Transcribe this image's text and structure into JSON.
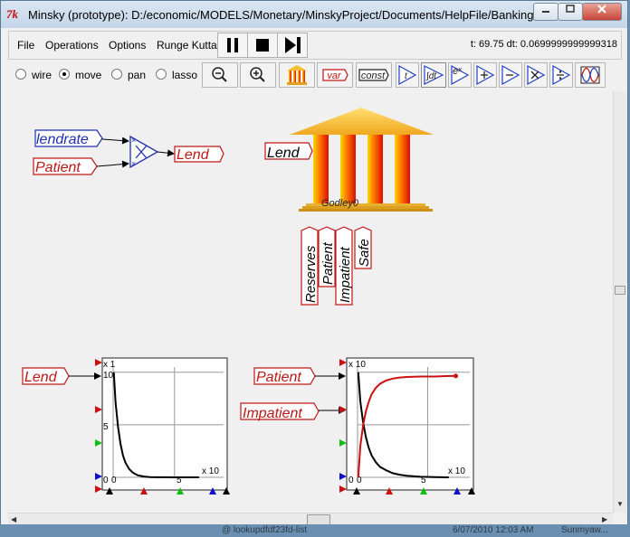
{
  "window": {
    "title": "Minsky (prototype): D:/economic/MODELS/Monetary/MinskyProject/Documents/HelpFile/BankingExa...",
    "app_icon": "tk-feather-icon"
  },
  "menu": {
    "file": "File",
    "operations": "Operations",
    "options": "Options",
    "runge_kutta": "Runge Kutta"
  },
  "run_controls": [
    "pause",
    "stop",
    "step"
  ],
  "status": {
    "text": "t: 69.75 dt: 0.0699999999999318"
  },
  "modes": {
    "wire": "wire",
    "move": "move",
    "pan": "pan",
    "lasso": "lasso",
    "selected": "move"
  },
  "toolbar": {
    "var_label": "var",
    "const_label": "const",
    "time_label": "t",
    "integral_label": "∫dt",
    "exp_label": "eˣ"
  },
  "canvas": {
    "inputs": {
      "lendrate": "lendrate",
      "patient": "Patient",
      "lend": "Lend"
    },
    "godley": {
      "name": "Godley0",
      "var": "Lend",
      "accounts": [
        "Reserves",
        "Patient",
        "Impatient",
        "Safe"
      ]
    },
    "plot1": {
      "input": "Lend",
      "y_exp": "x 1",
      "x_exp": "x 10",
      "y_max": "10",
      "y_mid": "5",
      "y_min": "0",
      "x_min": "0",
      "x_mid": "5"
    },
    "plot2": {
      "input1": "Patient",
      "input2": "Impatient",
      "y_exp": "x 10",
      "x_exp": "x 10",
      "y_min": "0",
      "x_min": "0",
      "x_mid": "5"
    }
  },
  "background_strip": [
    "@ lookupdfdf23fd-list",
    "6/07/2010 12:03 AM",
    "Sunmyaw..."
  ],
  "chart_data": [
    {
      "type": "line",
      "series": [
        {
          "values": [
            [
              0.05,
              10
            ],
            [
              0.2,
              7.1
            ],
            [
              0.4,
              4.8
            ],
            [
              0.6,
              3.2
            ],
            [
              0.8,
              2.1
            ],
            [
              1.0,
              1.4
            ],
            [
              1.3,
              0.8
            ],
            [
              1.6,
              0.45
            ],
            [
              2.0,
              0.2
            ],
            [
              2.5,
              0.08
            ],
            [
              3.0,
              0.03
            ],
            [
              3.5,
              0.01
            ],
            [
              4.0,
              0.01
            ],
            [
              5.0,
              0
            ],
            [
              6.0,
              0
            ],
            [
              7.0,
              0
            ]
          ],
          "color": "#000000"
        }
      ],
      "xlim": [
        0,
        9
      ],
      "ylim": [
        0,
        10.5
      ],
      "grid": true
    },
    {
      "type": "line",
      "series": [
        {
          "values": [
            [
              0.05,
              10
            ],
            [
              0.2,
              7.2
            ],
            [
              0.4,
              5.2
            ],
            [
              0.6,
              3.8
            ],
            [
              0.8,
              2.8
            ],
            [
              1.0,
              2.1
            ],
            [
              1.3,
              1.45
            ],
            [
              1.6,
              1.0
            ],
            [
              2.0,
              0.7
            ],
            [
              2.5,
              0.4
            ],
            [
              3.0,
              0.25
            ],
            [
              3.5,
              0.15
            ],
            [
              4.5,
              0.05
            ],
            [
              5.5,
              0.02
            ],
            [
              6.5,
              0
            ]
          ],
          "color": "#000000"
        },
        {
          "values": [
            [
              0.05,
              0
            ],
            [
              0.2,
              3.0
            ],
            [
              0.4,
              5.0
            ],
            [
              0.6,
              6.3
            ],
            [
              0.8,
              7.2
            ],
            [
              1.0,
              7.9
            ],
            [
              1.3,
              8.5
            ],
            [
              1.6,
              8.9
            ],
            [
              2.0,
              9.2
            ],
            [
              2.5,
              9.4
            ],
            [
              3.0,
              9.5
            ],
            [
              3.5,
              9.55
            ],
            [
              4.5,
              9.6
            ],
            [
              5.5,
              9.6
            ],
            [
              6.5,
              9.65
            ],
            [
              7.0,
              9.65
            ]
          ],
          "color": "#cc1010"
        }
      ],
      "xlim": [
        0,
        8
      ],
      "ylim": [
        0,
        10.5
      ],
      "grid": true
    }
  ]
}
